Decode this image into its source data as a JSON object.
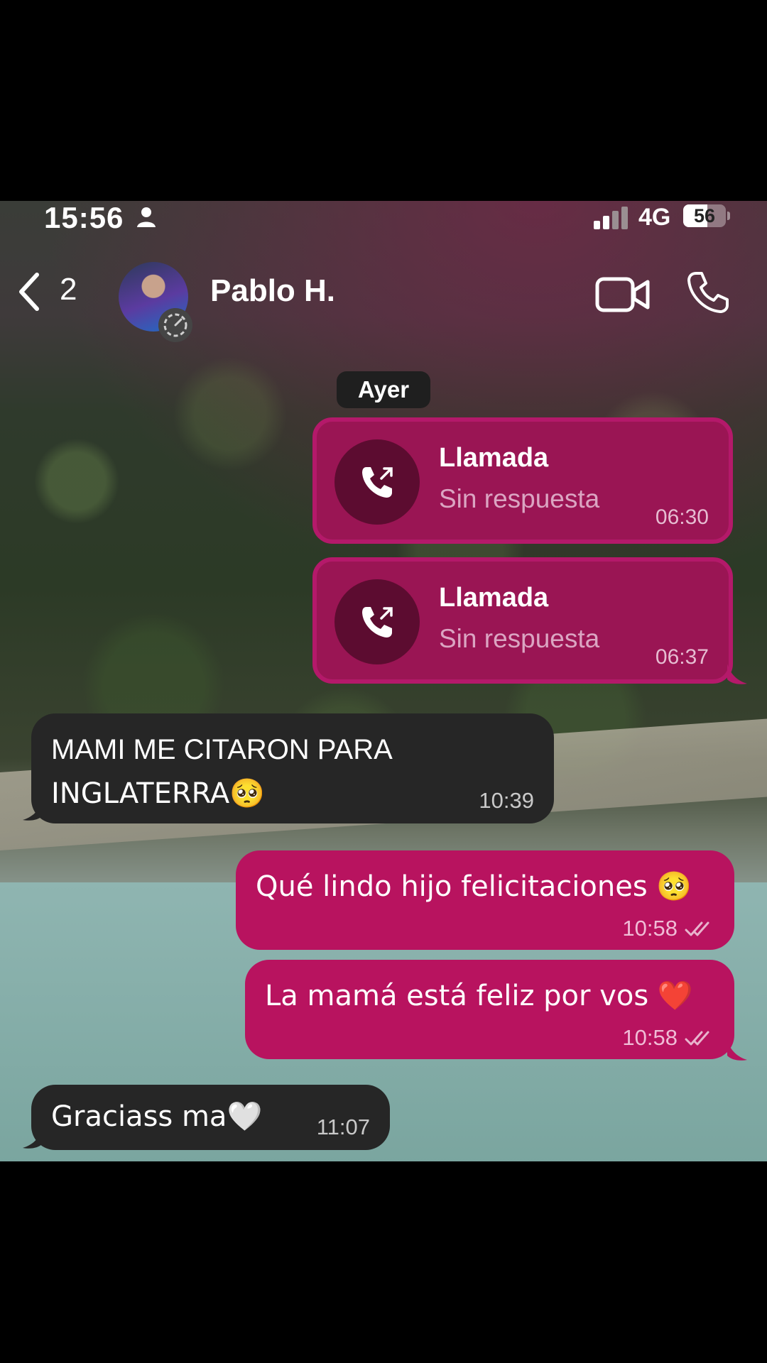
{
  "status_bar": {
    "time": "15:56",
    "network": "4G",
    "battery": "56",
    "battery_level": 0.56
  },
  "header": {
    "back_count": "2",
    "contact_name": "Pablo H."
  },
  "date_separator": "Ayer",
  "calls": [
    {
      "title": "Llamada",
      "subtitle": "Sin respuesta",
      "time": "06:30"
    },
    {
      "title": "Llamada",
      "subtitle": "Sin respuesta",
      "time": "06:37"
    }
  ],
  "messages": [
    {
      "direction": "in",
      "line1": "MAMI ME CITARON PARA",
      "line2": "INGLATERRA🥺",
      "time": "10:39"
    },
    {
      "direction": "out",
      "text": "Qué lindo hijo felicitaciones 🥺",
      "time": "10:58",
      "status": "read"
    },
    {
      "direction": "out",
      "text": "La mamá está feliz por vos ❤️",
      "time": "10:58",
      "status": "read"
    },
    {
      "direction": "in",
      "text": "Graciass ma🤍",
      "time": "11:07"
    }
  ],
  "colors": {
    "outgoing_bubble": "#b8135f",
    "call_bubble": "#9a1554",
    "incoming_bubble": "#262626"
  }
}
